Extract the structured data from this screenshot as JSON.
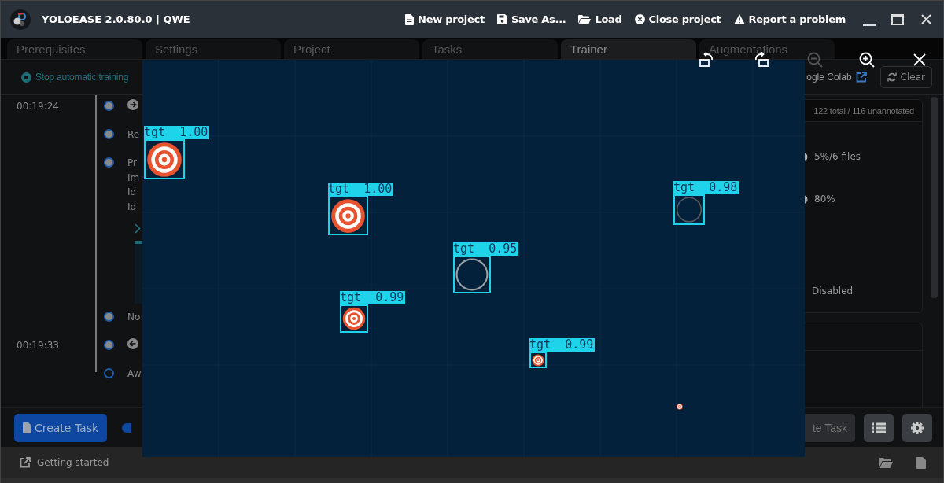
{
  "window": {
    "title": "YOLOEASE 2.0.80.0 | QWE",
    "menu": [
      {
        "label": "New project",
        "kind": "file"
      },
      {
        "label": "Save As...",
        "kind": "save"
      },
      {
        "label": "Load",
        "kind": "folder"
      },
      {
        "label": "Close project",
        "kind": "close"
      },
      {
        "label": "Report a problem",
        "kind": "warning"
      }
    ]
  },
  "tabs": [
    {
      "label": "Prerequisites",
      "selected": false
    },
    {
      "label": "Settings",
      "selected": false
    },
    {
      "label": "Project",
      "selected": false
    },
    {
      "label": "Tasks",
      "selected": false
    },
    {
      "label": "Trainer",
      "selected": true
    },
    {
      "label": "Augmentations",
      "selected": false
    }
  ],
  "toolbar": {
    "stop_button": "Stop automatic training",
    "colab_link": "ogle Colab",
    "clear_button": "Clear"
  },
  "timeline": [
    {
      "kind": "start",
      "time": "00:19:24"
    },
    {
      "kind": "event",
      "lines": [
        "Re"
      ]
    },
    {
      "kind": "event",
      "lines": [
        "Pr",
        "Im",
        "Id",
        "Id"
      ]
    },
    {
      "kind": "expander"
    },
    {
      "kind": "preview"
    },
    {
      "kind": "event",
      "lines": [
        "No"
      ]
    },
    {
      "kind": "end",
      "time": "00:19:33"
    },
    {
      "kind": "pending",
      "lines": [
        "Aw"
      ]
    }
  ],
  "dataset_card": {
    "header": "122 total / 116 unannotated",
    "rows": [
      {
        "kind": "slider",
        "value": "5%/6 files"
      },
      {
        "kind": "slider",
        "value": "80%"
      },
      {
        "kind": "text",
        "value": "Disabled"
      }
    ]
  },
  "actions": {
    "create_button": "Create Task",
    "toggle_on": true,
    "second_button": "te Task"
  },
  "status_bar": {
    "link": "Getting started"
  },
  "viewer": {
    "controls": [
      {
        "kind": "rotate-left",
        "disabled": false
      },
      {
        "kind": "rotate-right",
        "disabled": false
      },
      {
        "kind": "zoom-out",
        "disabled": true
      },
      {
        "kind": "zoom-in",
        "disabled": false
      },
      {
        "kind": "close",
        "disabled": false
      }
    ],
    "detections": [
      {
        "label": "tgt  1.00",
        "kind": "target"
      },
      {
        "label": "tgt  1.00",
        "kind": "target"
      },
      {
        "label": "tgt  0.98",
        "kind": "ring"
      },
      {
        "label": "tgt  0.95",
        "kind": "ring"
      },
      {
        "label": "tgt  0.99",
        "kind": "target"
      },
      {
        "label": "tgt  0.99",
        "kind": "target"
      }
    ]
  }
}
